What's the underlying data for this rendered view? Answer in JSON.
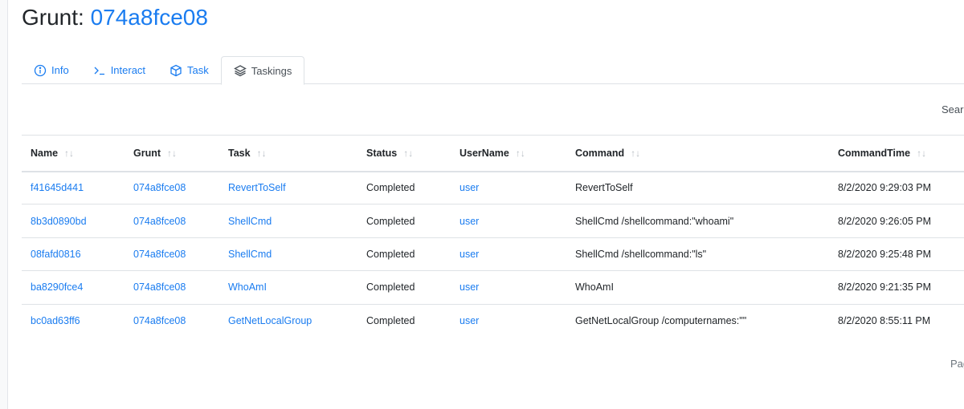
{
  "header": {
    "title_prefix": "Grunt:",
    "grunt_name": "074a8fce08"
  },
  "tabs": [
    {
      "label": "Info",
      "icon": "info-circle-icon"
    },
    {
      "label": "Interact",
      "icon": "terminal-icon"
    },
    {
      "label": "Task",
      "icon": "box-icon"
    },
    {
      "label": "Taskings",
      "icon": "layers-icon",
      "active": true
    }
  ],
  "search_label": "Searc",
  "table": {
    "columns": [
      "Name",
      "Grunt",
      "Task",
      "Status",
      "UserName",
      "Command",
      "CommandTime"
    ],
    "sort_icon": "↑↓",
    "rows": [
      {
        "name": "f41645d441",
        "grunt": "074a8fce08",
        "task": "RevertToSelf",
        "status": "Completed",
        "user": "user",
        "command": "RevertToSelf",
        "time": "8/2/2020 9:29:03 PM"
      },
      {
        "name": "8b3d0890bd",
        "grunt": "074a8fce08",
        "task": "ShellCmd",
        "status": "Completed",
        "user": "user",
        "command": "ShellCmd /shellcommand:\"whoami\"",
        "time": "8/2/2020 9:26:05 PM"
      },
      {
        "name": "08fafd0816",
        "grunt": "074a8fce08",
        "task": "ShellCmd",
        "status": "Completed",
        "user": "user",
        "command": "ShellCmd /shellcommand:\"ls\"",
        "time": "8/2/2020 9:25:48 PM"
      },
      {
        "name": "ba8290fce4",
        "grunt": "074a8fce08",
        "task": "WhoAmI",
        "status": "Completed",
        "user": "user",
        "command": "WhoAmI",
        "time": "8/2/2020 9:21:35 PM"
      },
      {
        "name": "bc0ad63ff6",
        "grunt": "074a8fce08",
        "task": "GetNetLocalGroup",
        "status": "Completed",
        "user": "user",
        "command": "GetNetLocalGroup /computernames:\"\"",
        "time": "8/2/2020 8:55:11 PM"
      }
    ]
  },
  "pagination_label": "Pag",
  "colors": {
    "link": "#1a7cf0",
    "text": "#212529",
    "border": "#dee2e6"
  }
}
